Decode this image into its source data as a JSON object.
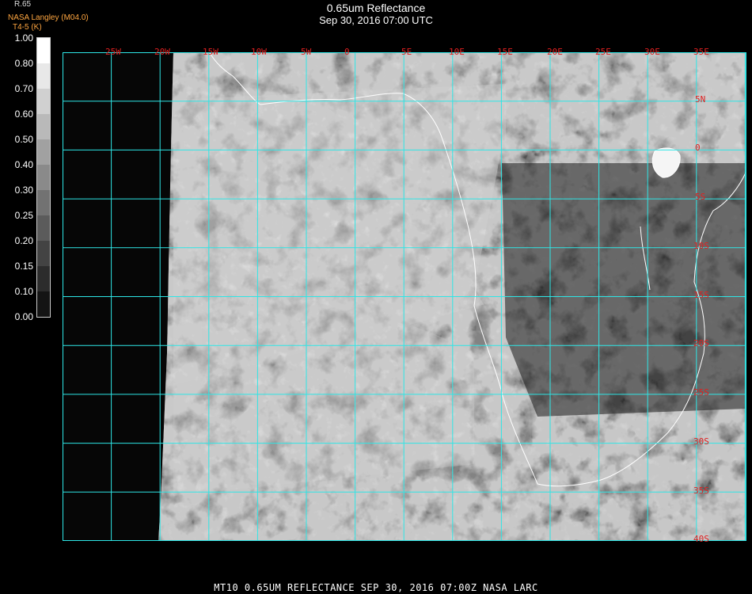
{
  "header": {
    "title": "0.65um Reflectance",
    "subtitle": "Sep 30, 2016 07:00 UTC",
    "credit_line1": "NASA Langley (M04.0)",
    "credit_line2": "T4-5 (K)",
    "legend_unit": "R.65"
  },
  "legend": {
    "ticks": [
      "1.00",
      "0.80",
      "0.70",
      "0.60",
      "0.50",
      "0.40",
      "0.30",
      "0.25",
      "0.20",
      "0.15",
      "0.10",
      "0.00"
    ]
  },
  "map": {
    "longitude_labels": [
      "25W",
      "20W",
      "15W",
      "10W",
      "5W",
      "0",
      "5E",
      "10E",
      "15E",
      "20E",
      "25E",
      "30E",
      "35E"
    ],
    "latitude_labels": [
      "5N",
      "0",
      "5S",
      "10S",
      "15S",
      "20S",
      "25S",
      "30S",
      "35S",
      "40S"
    ],
    "grid_color": "#2ee6e6",
    "label_color": "#e02020",
    "coastline_color": "#ffffff"
  },
  "footer": {
    "text": "MT10  0.65UM REFLECTANCE   SEP 30, 2016 07:00Z   NASA LARC"
  }
}
